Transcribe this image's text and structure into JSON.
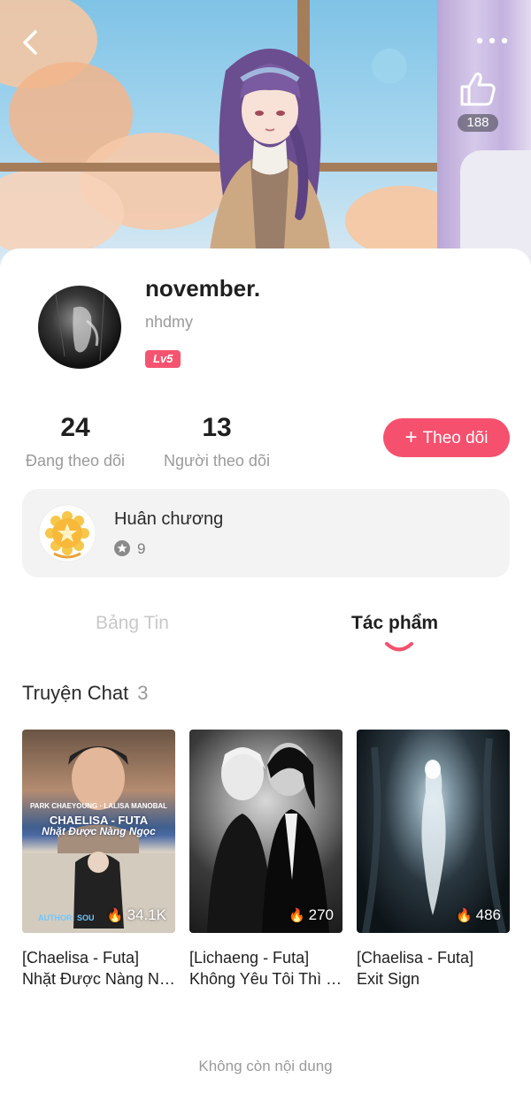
{
  "header": {
    "like_count": "188"
  },
  "profile": {
    "name": "november.",
    "handle": "nhdmy",
    "level": "Lv5",
    "following_count": "24",
    "following_label": "Đang theo dõi",
    "followers_count": "13",
    "followers_label": "Người theo dõi",
    "follow_button_label": "Theo dõi"
  },
  "medals": {
    "title": "Huân chương",
    "count": "9"
  },
  "tabs": [
    {
      "label": "Bảng Tin",
      "active": false
    },
    {
      "label": "Tác phẩm",
      "active": true
    }
  ],
  "section": {
    "title": "Truyện Chat",
    "count": "3"
  },
  "stories": [
    {
      "title_line1": "[Chaelisa - Futa]",
      "title_line2": "Nhặt Được Nàng Ngọc",
      "views": "34.1K",
      "cover_text_top": "PARK CHAEYOUNG · LALISA MANOBAL",
      "cover_text_mid": "CHAELISA - FUTA",
      "cover_text_sub": "Nhặt Được Nàng Ngọc",
      "cover_text_author": "AUTHOR: SOU"
    },
    {
      "title_line1": "[Lichaeng - Futa]",
      "title_line2": "Không Yêu Tôi Thì Sao",
      "views": "270"
    },
    {
      "title_line1": "[Chaelisa - Futa]",
      "title_line2": "Exit Sign",
      "views": "486"
    }
  ],
  "footer": {
    "end_text": "Không còn nội dung"
  },
  "colors": {
    "accent": "#f5506d",
    "level_badge": "#f4546f",
    "medal_bg": "#f3f3f3"
  }
}
